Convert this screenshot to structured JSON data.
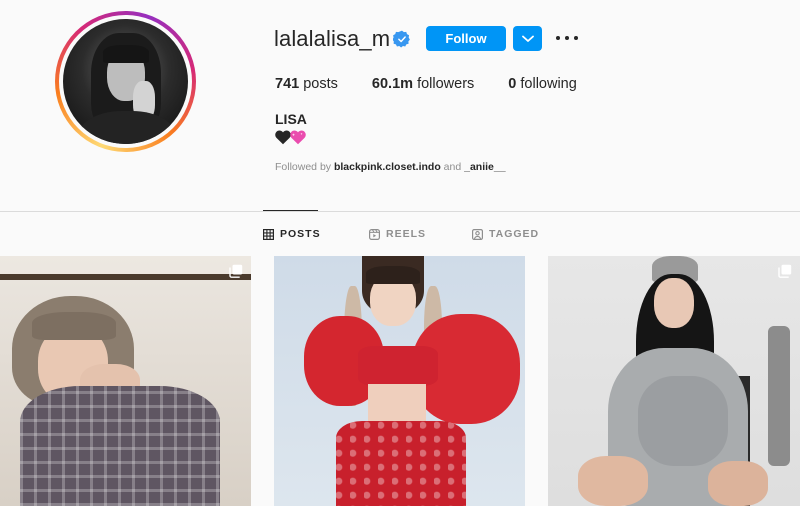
{
  "profile": {
    "username": "lalalalisa_m",
    "follow_label": "Follow",
    "full_name": "LISA",
    "bio_emoji": "🖤💗"
  },
  "stats": {
    "posts_count": "741",
    "posts_label": "posts",
    "followers_count": "60.1m",
    "followers_label": "followers",
    "following_count": "0",
    "following_label": "following"
  },
  "followed_by": {
    "prefix": "Followed by",
    "account_1": "blackpink.closet.indo",
    "joiner": "and",
    "account_2": "_aniie__"
  },
  "tabs": [
    {
      "label": "POSTS",
      "icon": "grid-icon",
      "active": true
    },
    {
      "label": "REELS",
      "icon": "reels-icon",
      "active": false
    },
    {
      "label": "TAGGED",
      "icon": "tagged-icon",
      "active": false
    }
  ],
  "posts": [
    {
      "icon": "multiple-photos-icon"
    },
    {
      "icon": "none"
    },
    {
      "icon": "multiple-photos-icon"
    }
  ],
  "colors": {
    "accent": "#0095f6",
    "verified": "#3897f0",
    "text_primary": "#262626",
    "text_secondary": "#8e8e8e",
    "background": "#fafafa",
    "divider": "#dbdbdb"
  }
}
